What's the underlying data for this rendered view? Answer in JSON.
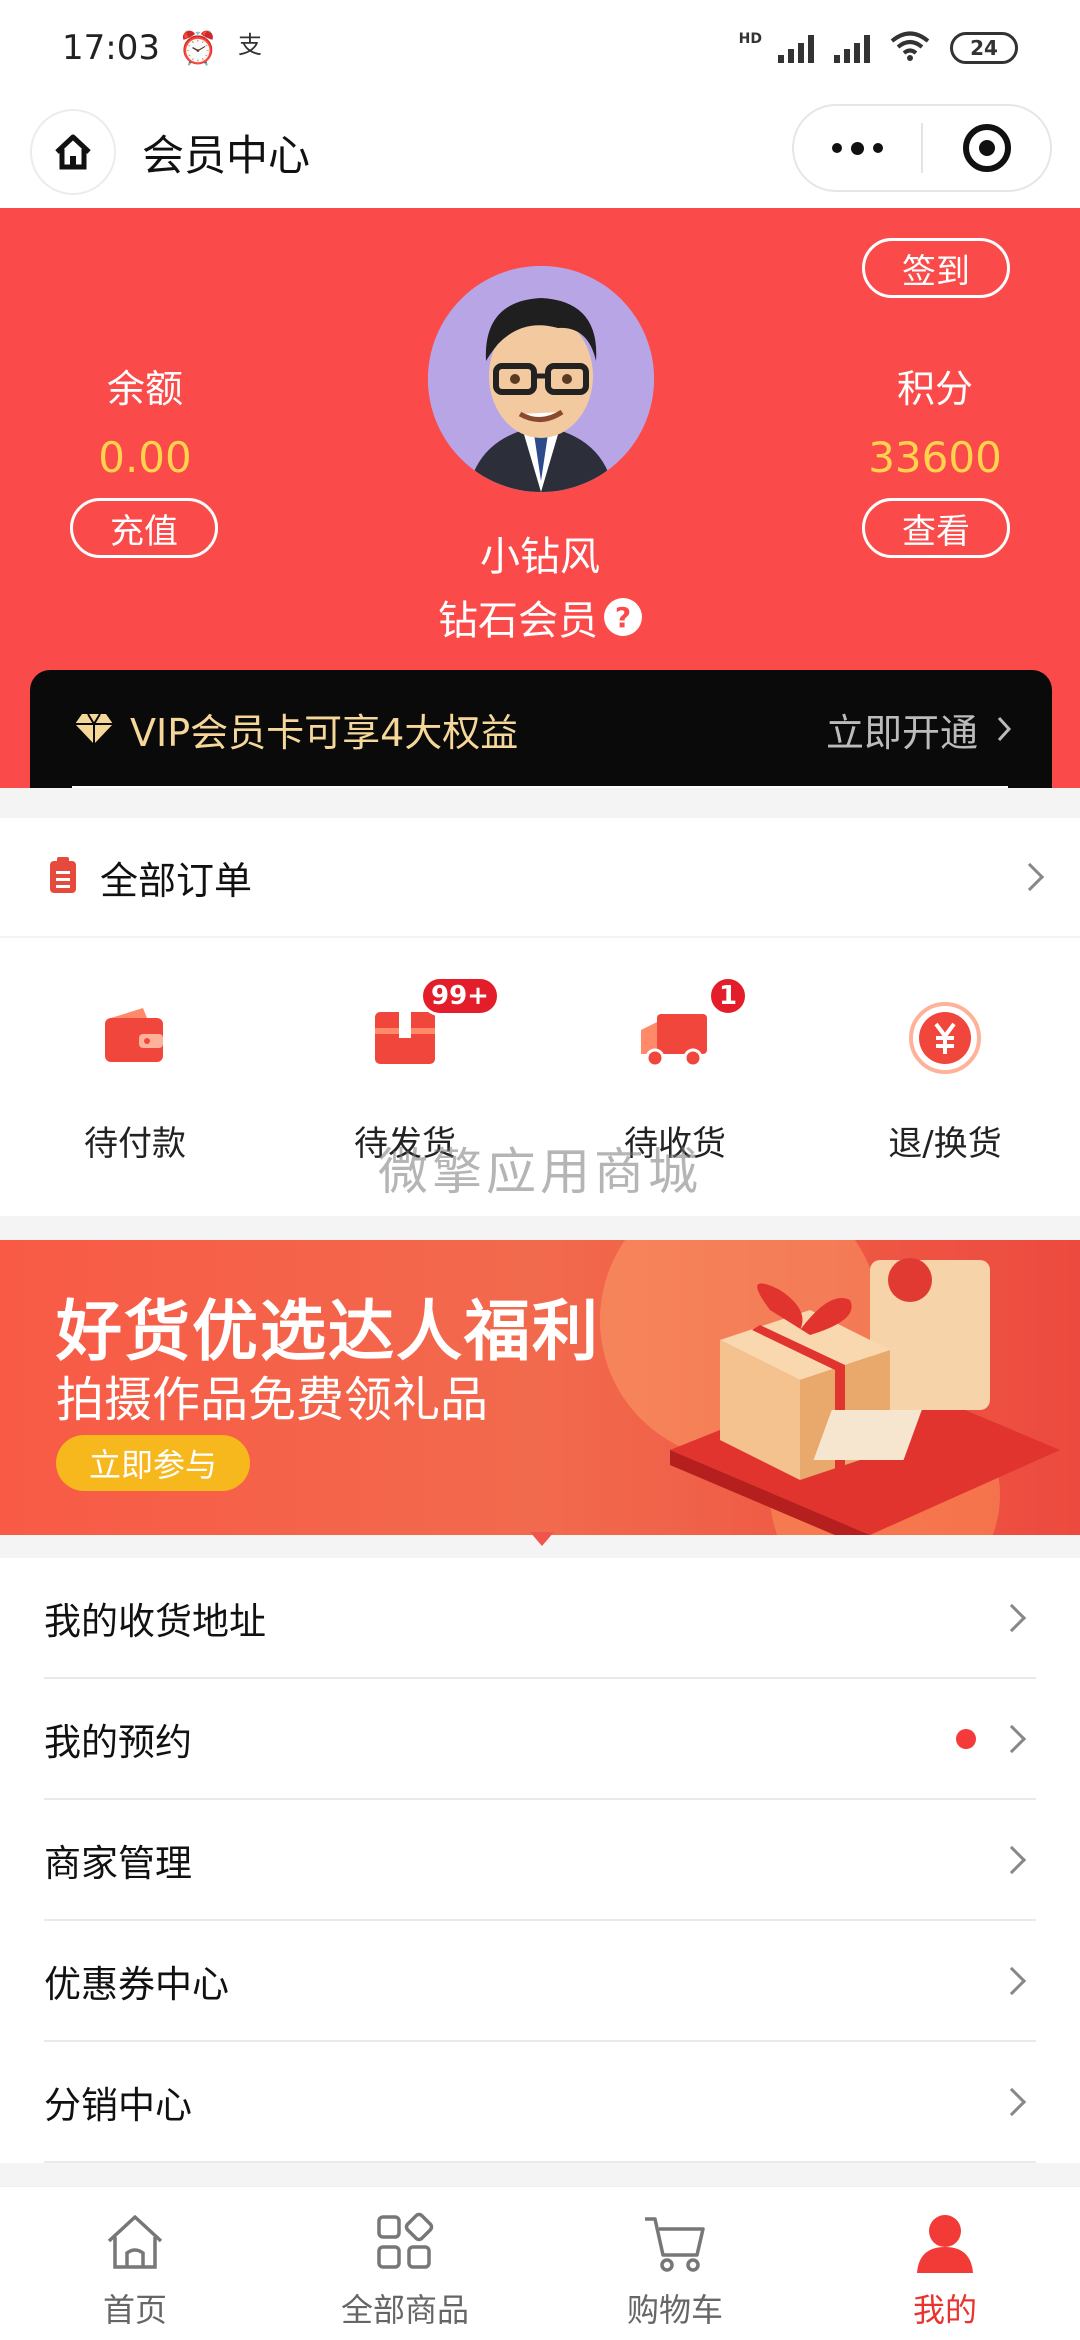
{
  "status_bar": {
    "time": "17:03",
    "battery": "24"
  },
  "nav": {
    "title": "会员中心"
  },
  "header": {
    "sign_in": "签到",
    "balance_label": "余额",
    "balance_value": "0.00",
    "recharge": "充值",
    "points_label": "积分",
    "points_value": "33600",
    "view": "查看",
    "username": "小钻风",
    "level": "钻石会员",
    "help": "?"
  },
  "vip": {
    "text": "VIP会员卡可享4大权益",
    "action": "立即开通"
  },
  "orders": {
    "title": "全部订单",
    "items": [
      {
        "label": "待付款",
        "icon": "wallet-icon"
      },
      {
        "label": "待发货",
        "icon": "box-icon",
        "badge": "99+"
      },
      {
        "label": "待收货",
        "icon": "truck-icon",
        "badge": "1"
      },
      {
        "label": "退/换货",
        "icon": "yuan-refund-icon"
      }
    ]
  },
  "watermark": "微擎应用商城",
  "banner": {
    "title": "好货优选达人福利",
    "subtitle": "拍摄作品免费领礼品",
    "button": "立即参与"
  },
  "menu": [
    {
      "label": "我的收货地址"
    },
    {
      "label": "我的预约"
    },
    {
      "label": "商家管理"
    },
    {
      "label": "优惠券中心"
    },
    {
      "label": "分销中心"
    }
  ],
  "tabbar": [
    {
      "label": "首页",
      "icon": "home-icon"
    },
    {
      "label": "全部商品",
      "icon": "grid-icon"
    },
    {
      "label": "购物车",
      "icon": "cart-icon"
    },
    {
      "label": "我的",
      "icon": "user-icon",
      "active": true
    }
  ],
  "colors": {
    "primary": "#fb4a4a",
    "accent_gold": "#ffd34d",
    "vip_bg": "#0a0a0a",
    "tab_active": "#e8332e"
  }
}
